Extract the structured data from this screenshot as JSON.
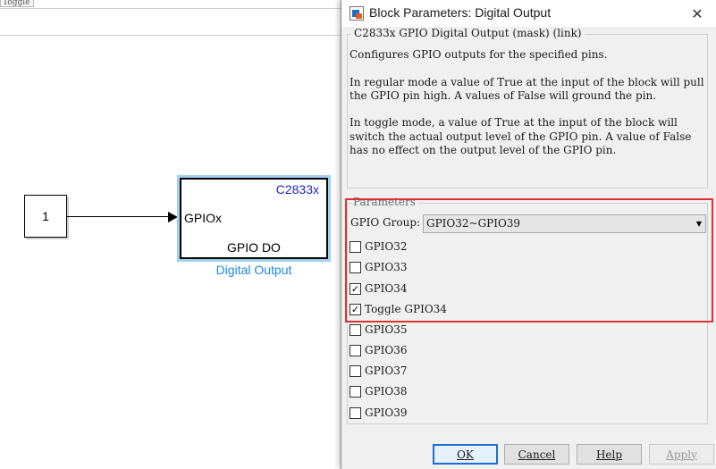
{
  "canvas": {
    "tab_stub": "Toggle",
    "constant_value": "1",
    "block": {
      "target": "C2833x",
      "input_port": "GPIOx",
      "block_label": "GPIO DO",
      "block_name": "Digital Output"
    }
  },
  "dialog": {
    "title": "Block Parameters: Digital Output",
    "close_glyph": "✕",
    "mask_title": "C2833x GPIO Digital Output (mask) (link)",
    "description": [
      "Configures GPIO outputs for the specified pins.",
      "In regular mode a value of True at the input of the block will pull the GPIO pin high. A values of False will ground the pin.",
      "In toggle mode, a value of True at the input of the block will switch the actual output level of the GPIO pin. A value of False has no effect on the output level of the GPIO pin."
    ],
    "parameters_title": "Parameters",
    "gpio_group": {
      "label": "GPIO Group:",
      "value": "GPIO32~GPIO39"
    },
    "checkboxes": [
      {
        "label": "GPIO32",
        "checked": false
      },
      {
        "label": "GPIO33",
        "checked": false
      },
      {
        "label": "GPIO34",
        "checked": true
      },
      {
        "label": "Toggle GPIO34",
        "checked": true
      },
      {
        "label": "GPIO35",
        "checked": false
      },
      {
        "label": "GPIO36",
        "checked": false
      },
      {
        "label": "GPIO37",
        "checked": false
      },
      {
        "label": "GPIO38",
        "checked": false
      },
      {
        "label": "GPIO39",
        "checked": false
      }
    ],
    "buttons": {
      "ok": "OK",
      "cancel": "Cancel",
      "help": "Help",
      "apply": "Apply"
    },
    "highlight_color": "#e03131"
  }
}
